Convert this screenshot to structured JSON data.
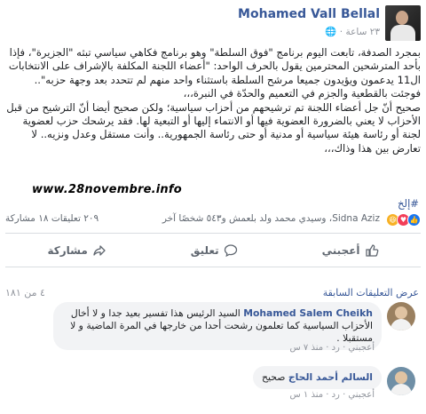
{
  "post": {
    "author": "Mohamed Vall Bellal",
    "time": "٢٣ ساعة",
    "paragraph1": "بمجرد الصدفة، تابعت اليوم برنامج \"فوق السلطة\" وهو برنامج فكاهي سياسي تبثه \"الجزيرة\"، فإذا بأحد المترشحين المحترمين يقول بالحرف الواحد: \"أعضاء اللجنة المكلفة بالإشراف على الانتخابات ال11 يدعمون ويؤيدون جميعا مرشح السلطة باستثناء واحد منهم لم تتحدد بعد وجهة حزبه\".. فوجئت بالقطعية والجزم في التعميم والحدّة في النبرة،،،",
    "paragraph2": "صحيح أنّ جل أعضاء اللجنة تم ترشيحهم من أحزاب سياسية؛ ولكن صحيح أيضا أنّ الترشيح من قبل الأحزاب لا يعني بالضرورة العضوية فيها أو الانتماء إليها أو التبعية لها. فقد يرشحك حزب لعضوية لجنة أو رئاسة هيئة سياسية أو مدنية أو حتى رئاسة الجمهورية.. وأنت مستقل وعدل ونزيه.. لا تعارض بين هذا وذاك،،،",
    "watermark": "www.28novembre.info",
    "hashtag": "#إلخ"
  },
  "reactions": {
    "reacted_text": "Sidna Aziz، وسيدي محمد ولد بلعمش و٥٤٣ شخصًا آخر",
    "counts_text": "٢٠٩ تعليقات ١٨ مشاركة",
    "icons": [
      "like-icon",
      "love-icon",
      "haha-icon"
    ]
  },
  "actions": {
    "like": "أعجبني",
    "comment": "تعليق",
    "share": "مشاركة"
  },
  "comments_header": {
    "previous": "عرض التعليقات السابقة",
    "count": "٤ من ١٨١"
  },
  "comments": [
    {
      "author": "Mohamed Salem Cheikh",
      "text": "السيد الرئيس هذا تفسير بعيد جدا و لا أخال الأحزاب السياسية كما تعلمون رشحت أحدا من خارجها في المرة الماضية و لا مستقبلا .",
      "meta": "أعجبني · رد · منذ ٧ س"
    },
    {
      "author": "السالم أحمد الحاج",
      "text": "صحيح",
      "meta": "أعجبني · رد · منذ ١ س"
    }
  ],
  "colors": {
    "link": "#385898",
    "muted": "#90949c",
    "bubble": "#f2f3f5"
  }
}
